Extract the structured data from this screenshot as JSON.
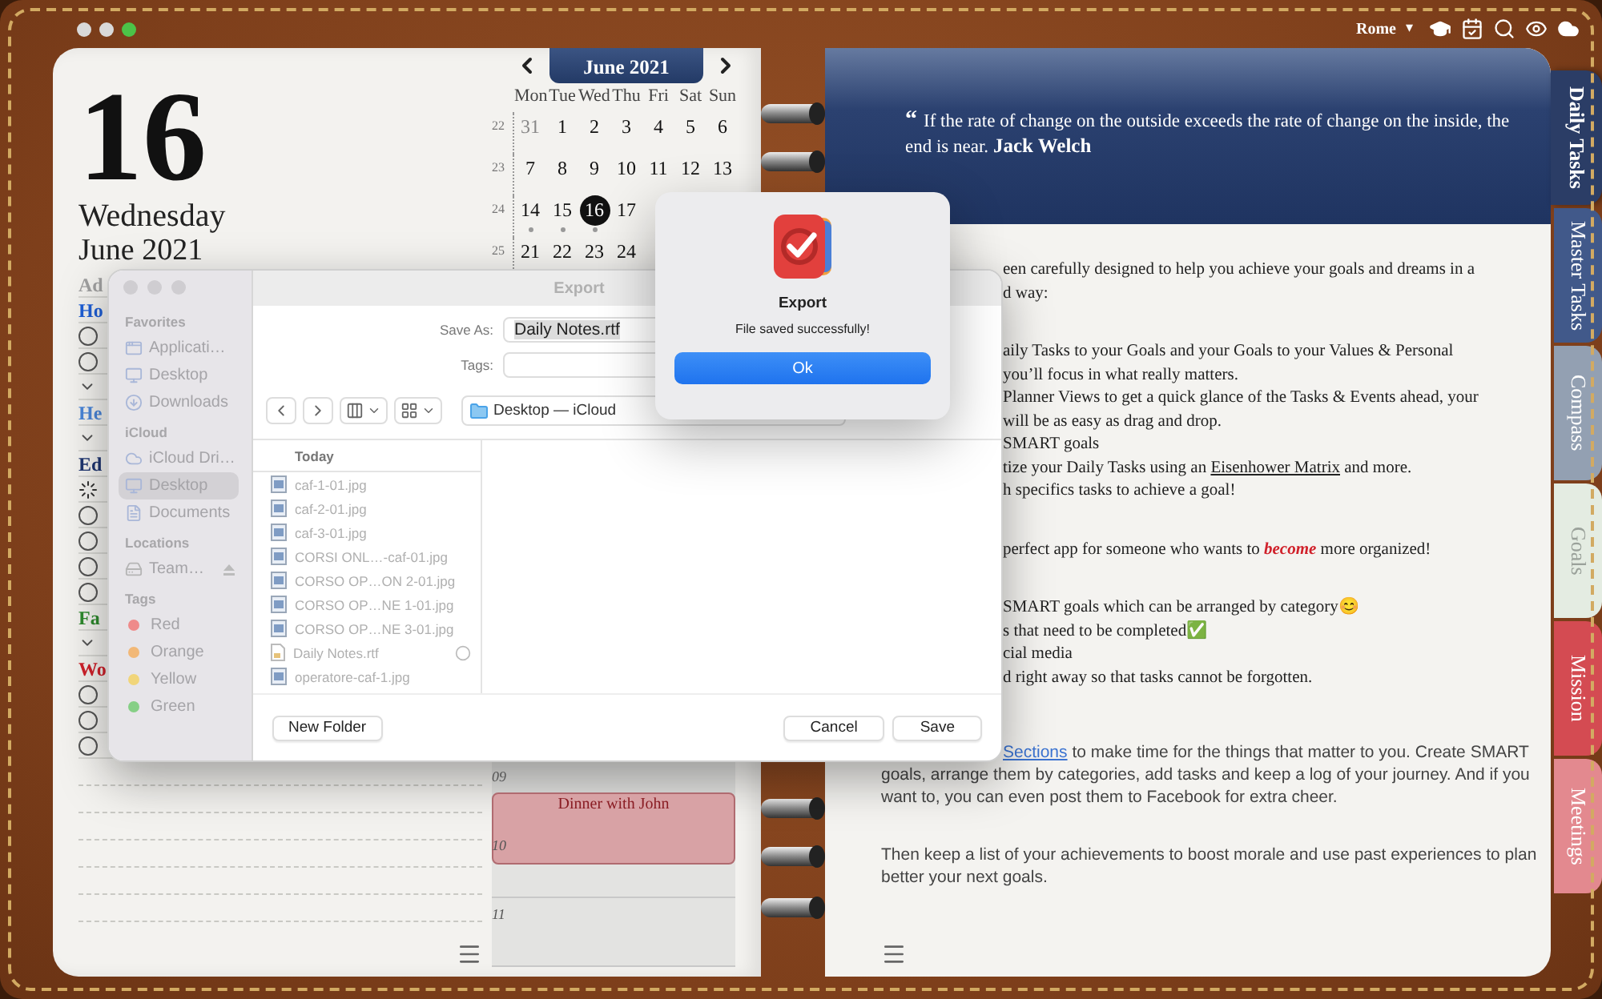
{
  "top_bar": {
    "location": "Rome",
    "location_caret": "▾"
  },
  "day": {
    "number": "16",
    "weekday": "Wednesday",
    "month_year": "June 2021"
  },
  "task_list": [
    {
      "kind": "header",
      "label": "Ad",
      "color": "#a0a0a0"
    },
    {
      "kind": "header",
      "label": "Ho",
      "color": "#1f5fd6"
    },
    {
      "kind": "task",
      "checked": false
    },
    {
      "kind": "task",
      "checked": false
    },
    {
      "kind": "toggle"
    },
    {
      "kind": "header",
      "label": "He",
      "color": "#4a86d9"
    },
    {
      "kind": "toggle"
    },
    {
      "kind": "header",
      "label": "Ed",
      "color": "#1e3570"
    },
    {
      "kind": "loading"
    },
    {
      "kind": "task",
      "checked": false
    },
    {
      "kind": "task",
      "checked": false
    },
    {
      "kind": "task",
      "checked": false
    },
    {
      "kind": "task",
      "checked": false
    },
    {
      "kind": "header",
      "label": "Fa",
      "color": "#2e8a2e"
    },
    {
      "kind": "toggle"
    },
    {
      "kind": "header",
      "label": "Wo",
      "color": "#d0202a"
    },
    {
      "kind": "task",
      "checked": false
    },
    {
      "kind": "task",
      "checked": false
    },
    {
      "kind": "task",
      "checked": false
    }
  ],
  "calendar": {
    "month": "June 2021",
    "weekdays": [
      "Mon",
      "Tue",
      "Wed",
      "Thu",
      "Fri",
      "Sat",
      "Sun"
    ],
    "weeks": [
      {
        "number": "22",
        "days": [
          {
            "day": "31",
            "muted": true,
            "selected": false,
            "has_event": false
          },
          {
            "day": "1",
            "muted": false,
            "selected": false,
            "has_event": false
          },
          {
            "day": "2",
            "muted": false,
            "selected": false,
            "has_event": false
          },
          {
            "day": "3",
            "muted": false,
            "selected": false,
            "has_event": false
          },
          {
            "day": "4",
            "muted": false,
            "selected": false,
            "has_event": false
          },
          {
            "day": "5",
            "muted": false,
            "selected": false,
            "has_event": false
          },
          {
            "day": "6",
            "muted": false,
            "selected": false,
            "has_event": false
          }
        ]
      },
      {
        "number": "23",
        "days": [
          {
            "day": "7",
            "muted": false,
            "selected": false,
            "has_event": false
          },
          {
            "day": "8",
            "muted": false,
            "selected": false,
            "has_event": false
          },
          {
            "day": "9",
            "muted": false,
            "selected": false,
            "has_event": false
          },
          {
            "day": "10",
            "muted": false,
            "selected": false,
            "has_event": false
          },
          {
            "day": "11",
            "muted": false,
            "selected": false,
            "has_event": false
          },
          {
            "day": "12",
            "muted": false,
            "selected": false,
            "has_event": false
          },
          {
            "day": "13",
            "muted": false,
            "selected": false,
            "has_event": false
          }
        ]
      },
      {
        "number": "24",
        "days": [
          {
            "day": "14",
            "muted": false,
            "selected": false,
            "has_event": true
          },
          {
            "day": "15",
            "muted": false,
            "selected": false,
            "has_event": true
          },
          {
            "day": "16",
            "muted": false,
            "selected": true,
            "has_event": true
          },
          {
            "day": "17",
            "muted": false,
            "selected": false,
            "has_event": false
          }
        ]
      },
      {
        "number": "25",
        "days": [
          {
            "day": "21",
            "muted": false,
            "selected": false,
            "has_event": false
          },
          {
            "day": "22",
            "muted": false,
            "selected": false,
            "has_event": false
          },
          {
            "day": "23",
            "muted": false,
            "selected": false,
            "has_event": false
          },
          {
            "day": "24",
            "muted": false,
            "selected": false,
            "has_event": false
          }
        ]
      }
    ]
  },
  "schedule": {
    "hours": [
      "09",
      "10",
      "11"
    ],
    "events": [
      {
        "title": "Dinner with John",
        "color": "#d8a2a5"
      }
    ]
  },
  "quote": {
    "mark": "“",
    "text": "If the rate of change on the outside exceeds the rate of change on the inside, the end is near.",
    "author": "Jack Welch"
  },
  "paragraphs": [
    {
      "kind": "fragments",
      "lines": [
        {
          "parts": [
            {
              "text": "een carefully designed to help you achieve your goals and dreams in a",
              "kind": "plain"
            }
          ]
        },
        {
          "parts": [
            {
              "text": "d way:",
              "kind": "plain"
            }
          ]
        }
      ]
    },
    {
      "kind": "fragments",
      "lines": [
        {
          "parts": [
            {
              "text": "aily Tasks to your Goals and your Goals to your Values & Personal",
              "kind": "plain"
            }
          ]
        },
        {
          "parts": [
            {
              "text": "you’ll focus in what really matters.",
              "kind": "plain"
            }
          ]
        },
        {
          "parts": [
            {
              "text": "Planner Views to get a quick glance of the Tasks & Events ahead, your",
              "kind": "plain"
            }
          ]
        },
        {
          "parts": [
            {
              "text": "will be as easy as drag and drop.",
              "kind": "plain"
            }
          ]
        },
        {
          "parts": [
            {
              "text": "SMART goals",
              "kind": "plain"
            }
          ]
        },
        {
          "parts": [
            {
              "text": "tize your Daily Tasks using an ",
              "kind": "plain"
            },
            {
              "text": "Eisenhower Matrix",
              "kind": "link"
            },
            {
              "text": " and more.",
              "kind": "plain"
            }
          ]
        },
        {
          "parts": [
            {
              "text": "h specifics tasks to achieve a goal!",
              "kind": "plain"
            }
          ]
        }
      ]
    },
    {
      "kind": "fragments",
      "lines": [
        {
          "parts": [
            {
              "text": "perfect app for someone who wants to ",
              "kind": "plain"
            },
            {
              "text": "become",
              "kind": "emphasis"
            },
            {
              "text": " more organized!",
              "kind": "plain"
            }
          ]
        }
      ]
    },
    {
      "kind": "fragments",
      "lines": [
        {
          "parts": [
            {
              "text": "SMART goals which can be arranged by category😊",
              "kind": "plain"
            }
          ]
        },
        {
          "parts": [
            {
              "text": "s that need to be completed✅",
              "kind": "plain"
            }
          ]
        },
        {
          "parts": [
            {
              "text": "cial media",
              "kind": "plain"
            }
          ]
        },
        {
          "parts": [
            {
              "text": "d right away so that tasks cannot be forgotten.",
              "kind": "plain"
            }
          ]
        }
      ]
    },
    {
      "kind": "prose",
      "parts": [
        {
          "text": "Sections",
          "kind": "link"
        },
        {
          "text": " to make time for the things that matter to you. Create SMART goals, arrange them by categories, add tasks and keep a log of your journey. And if you want to, you can even post them to Facebook for extra cheer.",
          "kind": "plain"
        }
      ]
    },
    {
      "kind": "prose",
      "parts": [
        {
          "text": "Then keep a list of your achievements to boost morale and use past experiences to plan better your next goals.",
          "kind": "plain"
        }
      ]
    }
  ],
  "tabs": [
    {
      "label": "Daily Tasks",
      "color": "#2b3d66",
      "selected": true
    },
    {
      "label": "Master Tasks",
      "color": "#41598a",
      "selected": false
    },
    {
      "label": "Compass",
      "color": "#93a0b2",
      "selected": false
    },
    {
      "label": "Goals",
      "color": "#e4ece2",
      "selected": false
    },
    {
      "label": "Mission",
      "color": "#d44b52",
      "selected": false
    },
    {
      "label": "Meetings",
      "color": "#e3898f",
      "selected": false
    }
  ],
  "export_dialog": {
    "title": "Export",
    "sidebar": [
      {
        "heading": "Favorites",
        "items": [
          {
            "label": "Applicati…",
            "kind": "apps",
            "selected": false
          },
          {
            "label": "Desktop",
            "kind": "desktop",
            "selected": false
          },
          {
            "label": "Downloads",
            "kind": "downloads",
            "selected": false
          }
        ]
      },
      {
        "heading": "iCloud",
        "items": [
          {
            "label": "iCloud Dri…",
            "kind": "cloud",
            "selected": false
          },
          {
            "label": "Desktop",
            "kind": "desktop",
            "selected": true
          },
          {
            "label": "Documents",
            "kind": "document",
            "selected": false
          }
        ]
      },
      {
        "heading": "Locations",
        "items": [
          {
            "label": "Team…",
            "kind": "drive",
            "selected": false
          }
        ]
      },
      {
        "heading": "Tags",
        "items": [
          {
            "label": "Red",
            "kind": "tag",
            "color": "#ef8a8a",
            "selected": false
          },
          {
            "label": "Orange",
            "kind": "tag",
            "color": "#f2b877",
            "selected": false
          },
          {
            "label": "Yellow",
            "kind": "tag",
            "color": "#f1d57a",
            "selected": false
          },
          {
            "label": "Green",
            "kind": "tag",
            "color": "#86cf86",
            "selected": false
          }
        ]
      }
    ],
    "save_as_label": "Save As:",
    "save_as_value": "Daily Notes.rtf",
    "tags_label": "Tags:",
    "location": "Desktop — iCloud",
    "list_header": "Today",
    "files": [
      {
        "name": "caf-1-01.jpg",
        "kind": "image",
        "syncing": false
      },
      {
        "name": "caf-2-01.jpg",
        "kind": "image",
        "syncing": false
      },
      {
        "name": "caf-3-01.jpg",
        "kind": "image",
        "syncing": false
      },
      {
        "name": "CORSI ONL…-caf-01.jpg",
        "kind": "image",
        "syncing": false
      },
      {
        "name": "CORSO OP…ON 2-01.jpg",
        "kind": "image",
        "syncing": false
      },
      {
        "name": "CORSO OP…NE 1-01.jpg",
        "kind": "image",
        "syncing": false
      },
      {
        "name": "CORSO OP…NE 3-01.jpg",
        "kind": "image",
        "syncing": false
      },
      {
        "name": "Daily Notes.rtf",
        "kind": "document",
        "syncing": true
      },
      {
        "name": "operatore-caf-1.jpg",
        "kind": "image",
        "syncing": false
      }
    ],
    "new_folder": "New Folder",
    "cancel": "Cancel",
    "save": "Save"
  },
  "alert": {
    "title": "Export",
    "message": "File saved successfully!",
    "button": "Ok"
  }
}
